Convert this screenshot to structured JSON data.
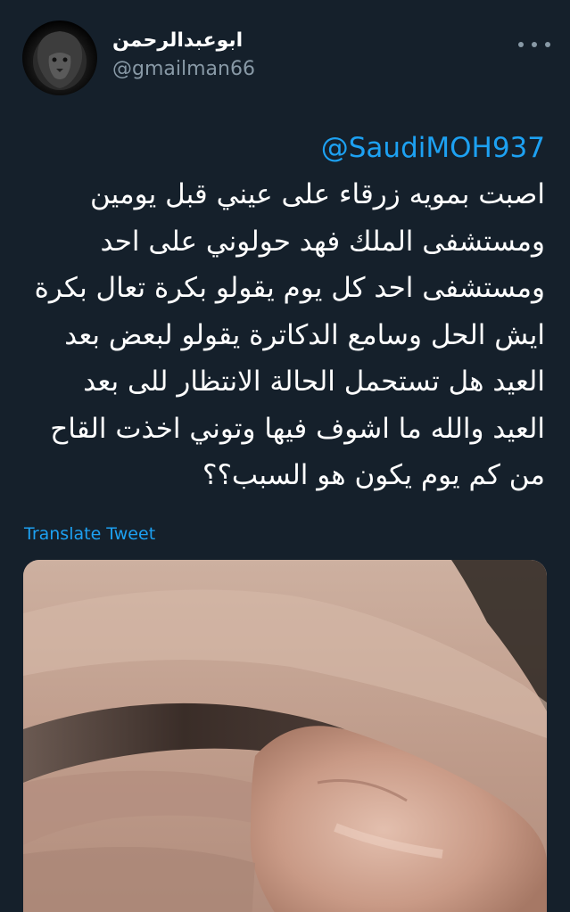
{
  "tweet": {
    "display_name": "ابوعبدالرحمن",
    "username": "@gmailman66",
    "mention": "@SaudiMOH937",
    "body_lines": [
      "اصبت بمويه زرقاء على عيني قبل يومين",
      "ومستشفى الملك فهد حولوني على احد",
      "ومستشفى احد كل يوم يقولو بكرة تعال بكرة",
      "ايش الحل وسامع الدكاترة يقولو لبعض بعد",
      "العيد هل تستحمل الحالة الانتظار للى بعد",
      "العيد والله ما اشوف فيها وتوني اخذت القاح",
      "من كم يوم يكون هو السبب؟؟"
    ],
    "translate_label": "Translate Tweet"
  },
  "icons": {
    "more": "more-dots-icon",
    "avatar": "lion-avatar"
  },
  "colors": {
    "background": "#15202b",
    "link": "#1da1f2",
    "secondary_text": "#8899a6",
    "primary_text": "#ffffff"
  }
}
